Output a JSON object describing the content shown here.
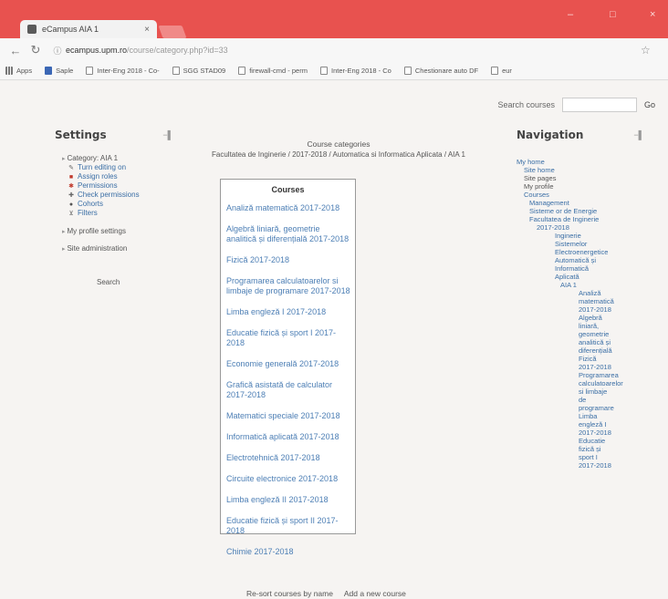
{
  "browser": {
    "tab_title": "eCampus AIA 1",
    "url_host": "ecampus.upm.ro",
    "url_path": "/course/category.php?id=33",
    "bookmarks": [
      {
        "label": "Apps",
        "icon": "apps-grid-icon"
      },
      {
        "label": "Saple",
        "icon": "folder-icon"
      },
      {
        "label": "Inter-Eng 2018 - Co-",
        "icon": "page-icon"
      },
      {
        "label": "SGG STAD09",
        "icon": "page-icon"
      },
      {
        "label": "firewall-cmd - perm",
        "icon": "page-icon"
      },
      {
        "label": "Inter-Eng 2018 - Co",
        "icon": "page-icon"
      },
      {
        "label": "Chestionare auto DF",
        "icon": "page-icon"
      },
      {
        "label": "eur",
        "icon": "page-icon"
      }
    ]
  },
  "header": {
    "search_label": "Search courses",
    "go_label": "Go"
  },
  "settings": {
    "title": "Settings",
    "category": "Category: AIA 1",
    "items": [
      {
        "label": "Turn editing on",
        "icon": "edit-icon"
      },
      {
        "label": "Assign roles",
        "icon": "roles-icon"
      },
      {
        "label": "Permissions",
        "icon": "permissions-icon"
      },
      {
        "label": "Check permissions",
        "icon": "check-permissions-icon"
      },
      {
        "label": "Cohorts",
        "icon": "cohorts-icon"
      },
      {
        "label": "Filters",
        "icon": "filter-icon"
      }
    ],
    "profile_settings": "My profile settings",
    "site_admin": "Site administration",
    "search": "Search"
  },
  "main": {
    "title": "Course categories",
    "breadcrumb": "Facultatea de Inginerie / 2017-2018 / Automatica si Informatica Aplicata / AIA 1",
    "courses_header": "Courses",
    "courses": [
      "Analiză matematică 2017-2018",
      "Algebră liniară, geometrie analitică și diferențială 2017-2018",
      "Fizică 2017-2018",
      "Programarea calculatoarelor si limbaje de programare 2017-2018",
      "Limba engleză I 2017-2018",
      "Educatie fizică și sport I 2017-2018",
      "Economie generală 2017-2018",
      "Grafică asistată de calculator 2017-2018",
      "Matematici speciale 2017-2018",
      "Informatică aplicată 2017-2018",
      "Electrotehnică 2017-2018",
      "Circuite electronice 2017-2018",
      "Limba engleză II 2017-2018",
      "Educatie fizică și sport II 2017-2018",
      "Chimie 2017-2018"
    ],
    "resort_label": "Re-sort courses by name",
    "add_course_label": "Add a new course"
  },
  "navigation": {
    "title": "Navigation",
    "items": [
      {
        "label": "My home",
        "link": true,
        "indent": 0
      },
      {
        "label": "Site home",
        "link": true,
        "indent": 1
      },
      {
        "label": "Site pages",
        "link": false,
        "indent": 1
      },
      {
        "label": "My profile",
        "link": false,
        "indent": 1
      },
      {
        "label": "Courses",
        "link": true,
        "indent": 1
      },
      {
        "label": "Management",
        "link": true,
        "indent": 2
      },
      {
        "label": "Sisteme or de Energie",
        "link": true,
        "indent": 2
      },
      {
        "label": "Facultatea de Inginerie",
        "link": true,
        "indent": 2
      },
      {
        "label": "2017-2018",
        "link": true,
        "indent": 3
      },
      {
        "label": "Inginerie",
        "link": true,
        "indent": 4
      },
      {
        "label": "Sistemelor",
        "link": true,
        "indent": 4
      },
      {
        "label": "Electroenergetice",
        "link": true,
        "indent": 4
      },
      {
        "label": "Automatică și",
        "link": true,
        "indent": 4
      },
      {
        "label": "Informatică",
        "link": true,
        "indent": 4
      },
      {
        "label": "Aplicată",
        "link": true,
        "indent": 4
      },
      {
        "label": "AIA 1",
        "link": true,
        "indent": 5
      },
      {
        "label": "Analiză",
        "link": true,
        "indent": 6
      },
      {
        "label": "matematică",
        "link": true,
        "indent": 6
      },
      {
        "label": "2017-2018",
        "link": true,
        "indent": 6
      },
      {
        "label": "Algebră",
        "link": true,
        "indent": 6
      },
      {
        "label": "liniară,",
        "link": true,
        "indent": 6
      },
      {
        "label": "geometrie",
        "link": true,
        "indent": 6
      },
      {
        "label": "analitică și",
        "link": true,
        "indent": 6
      },
      {
        "label": "diferențială",
        "link": true,
        "indent": 6
      },
      {
        "label": "Fizică",
        "link": true,
        "indent": 6
      },
      {
        "label": "2017-2018",
        "link": true,
        "indent": 6
      },
      {
        "label": "Programarea",
        "link": true,
        "indent": 6
      },
      {
        "label": "calculatoarelor",
        "link": true,
        "indent": 6
      },
      {
        "label": "si limbaje",
        "link": true,
        "indent": 6
      },
      {
        "label": "de",
        "link": true,
        "indent": 6
      },
      {
        "label": "programare",
        "link": true,
        "indent": 6
      },
      {
        "label": "Limba",
        "link": true,
        "indent": 6
      },
      {
        "label": "engleză I",
        "link": true,
        "indent": 6
      },
      {
        "label": "2017-2018",
        "link": true,
        "indent": 6
      },
      {
        "label": "Educatie",
        "link": true,
        "indent": 6
      },
      {
        "label": "fizică și",
        "link": true,
        "indent": 6
      },
      {
        "label": "sport I",
        "link": true,
        "indent": 6
      },
      {
        "label": "2017-2018",
        "link": true,
        "indent": 6
      }
    ]
  }
}
